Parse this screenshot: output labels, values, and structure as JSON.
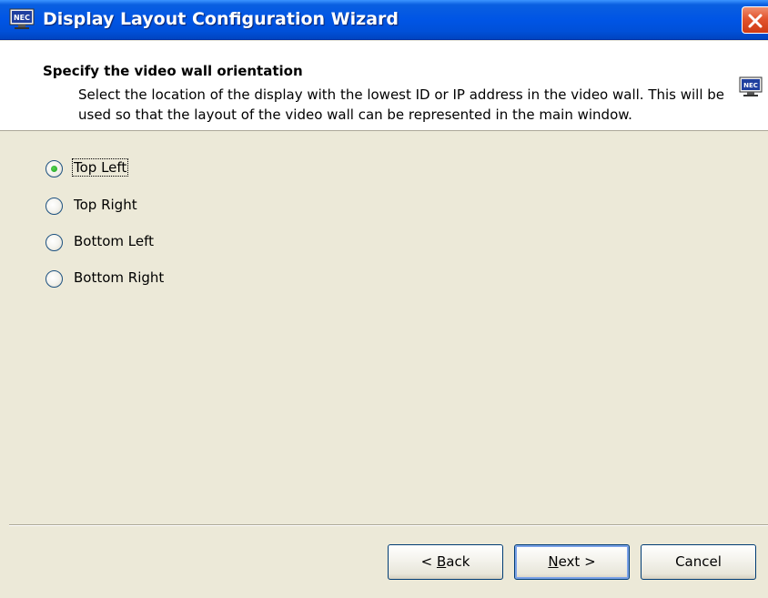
{
  "window": {
    "title": "Display Layout Configuration Wizard",
    "icon": "nec-monitor-icon",
    "close_icon": "close-icon"
  },
  "header": {
    "title": "Specify the video wall orientation",
    "description": "Select the location of the display with the lowest ID or IP address in the video wall. This will be used so that the layout of the video wall can be represented in the main window.",
    "icon": "nec-monitor-icon",
    "icon_text": "NEC"
  },
  "options": [
    {
      "label": "Top Left",
      "checked": true
    },
    {
      "label": "Top Right",
      "checked": false
    },
    {
      "label": "Bottom Left",
      "checked": false
    },
    {
      "label": "Bottom Right",
      "checked": false
    }
  ],
  "buttons": {
    "back": {
      "prefix": "< ",
      "mnemonic": "B",
      "rest": "ack"
    },
    "next": {
      "prefix": "",
      "mnemonic": "N",
      "rest": "ext >"
    },
    "cancel": {
      "label": "Cancel"
    }
  },
  "colors": {
    "titlebar": "#0055e5",
    "close": "#e2542e",
    "dialog_bg": "#ece9d8",
    "radio_dot": "#21a121"
  }
}
